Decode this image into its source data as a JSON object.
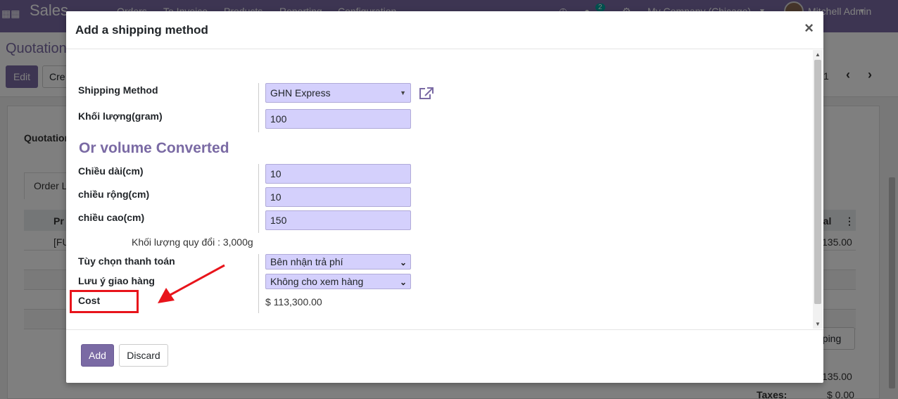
{
  "app": {
    "name": "Sales",
    "menu": [
      "Orders",
      "To Invoice",
      "Products",
      "Reporting",
      "Configuration"
    ],
    "message_count": "2",
    "company": "My Company (Chicago)",
    "user": "Mitchell Admin"
  },
  "control_panel": {
    "breadcrumb": "Quotation",
    "edit_label": "Edit",
    "create_label": "Cre",
    "pager": "1"
  },
  "background_form": {
    "section_label": "Quotation",
    "tab_label": "Order L",
    "col_product": "Pr",
    "col_total": "tal",
    "row1_product": "[FU",
    "row1_total": "135.00",
    "shipping_btn": "pping",
    "untaxed_value": "135.00",
    "taxes_label": "Taxes:",
    "taxes_value": "$ 0.00"
  },
  "modal": {
    "title": "Add a shipping method",
    "close_label": "×",
    "shipping_method_label": "Shipping Method",
    "shipping_method_value": "GHN Express",
    "weight_label": "Khối lượng(gram)",
    "weight_value": "100",
    "volume_section_title": "Or volume Converted",
    "length_label": "Chiều dài(cm)",
    "length_value": "10",
    "width_label": "chiều rộng(cm)",
    "width_value": "10",
    "height_label": "chiều cao(cm)",
    "height_value": "150",
    "converted_weight_text": "Khối lượng quy đổi : 3,000g",
    "payment_option_label": "Tùy chọn thanh toán",
    "payment_option_value": "Bên nhận trả phí",
    "delivery_note_label": "Lưu ý giao hàng",
    "delivery_note_value": "Không cho xem hàng",
    "cost_label": "Cost",
    "cost_value": "$ 113,300.00",
    "add_label": "Add",
    "discard_label": "Discard"
  },
  "colors": {
    "brand": "#7a6aa4",
    "field_bg": "#d4d0fc",
    "annotation_red": "#e8141b"
  },
  "icons": [
    "apps-icon",
    "external-link-icon",
    "close-icon",
    "chevron-down-icon",
    "caret-down-icon",
    "annotation-arrow-icon"
  ]
}
